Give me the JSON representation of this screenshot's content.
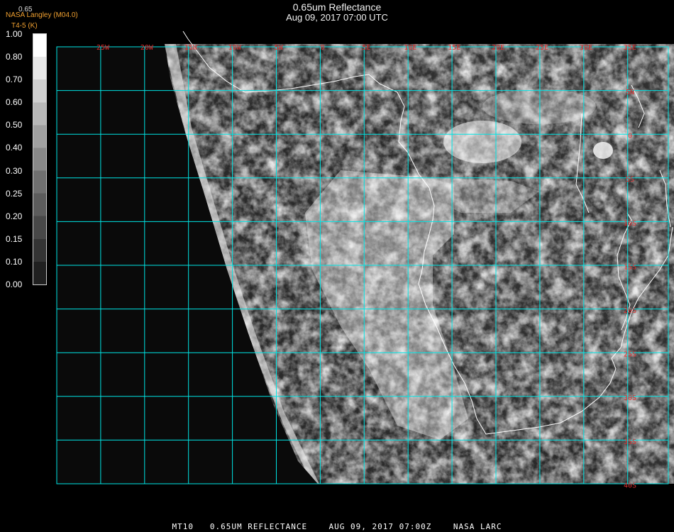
{
  "title": {
    "line1": "0.65um Reflectance",
    "line2": "Aug 09, 2017 07:00 UTC"
  },
  "credit": {
    "top": "0.65",
    "source": "NASA Langley (M04.0)",
    "product": "T4-5 (K)"
  },
  "colorbar": {
    "labels": [
      "1.00",
      "0.80",
      "0.70",
      "0.60",
      "0.50",
      "0.40",
      "0.30",
      "0.25",
      "0.20",
      "0.15",
      "0.10",
      "0.00"
    ]
  },
  "map": {
    "lon_labels": [
      "25W",
      "20W",
      "15W",
      "10W",
      "5W",
      "0",
      "5E",
      "10E",
      "15E",
      "20E",
      "25E",
      "30E",
      "35E"
    ],
    "lat_labels": [
      "5N",
      "0",
      "5S",
      "10S",
      "15S",
      "20S",
      "25S",
      "30S",
      "35S",
      "40S"
    ],
    "grid_color": "#00e5e5",
    "label_color": "#e03030",
    "coast_color": "#ffffff"
  },
  "footer": "MT10   0.65UM REFLECTANCE    AUG 09, 2017 07:00Z    NASA LARC"
}
